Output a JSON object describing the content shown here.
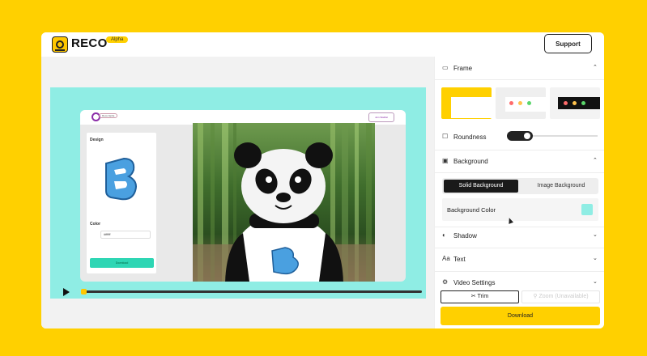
{
  "header": {
    "brand": "RECO",
    "badge": "Alpha",
    "support_label": "Support"
  },
  "preview": {
    "inner_badge": "Reco Alpha",
    "inner_button": "Join Waitlist",
    "design_label": "Design",
    "color_label": "Color",
    "color_value": "#ffffff",
    "download_label": "Download"
  },
  "panel": {
    "frame": {
      "label": "Frame",
      "icon": "frame-icon"
    },
    "roundness": {
      "label": "Roundness",
      "enabled": true
    },
    "background": {
      "label": "Background",
      "tabs": [
        "Solid Background",
        "Image Background"
      ],
      "active_tab": "Solid Background",
      "color_label": "Background Color",
      "color": "#8FEDE4"
    },
    "shadow": {
      "label": "Shadow"
    },
    "text": {
      "label": "Text"
    },
    "video_settings": {
      "label": "Video Settings"
    },
    "trim_label": "Trim",
    "zoom_label": "Zoom (Unavailable)",
    "download_label": "Download"
  },
  "colors": {
    "page_bg": "#FFD000",
    "accent": "#FFC700",
    "stage_bg": "#8FEDE4",
    "dark": "#1a1a1a"
  },
  "playback": {
    "progress": 0.0
  }
}
